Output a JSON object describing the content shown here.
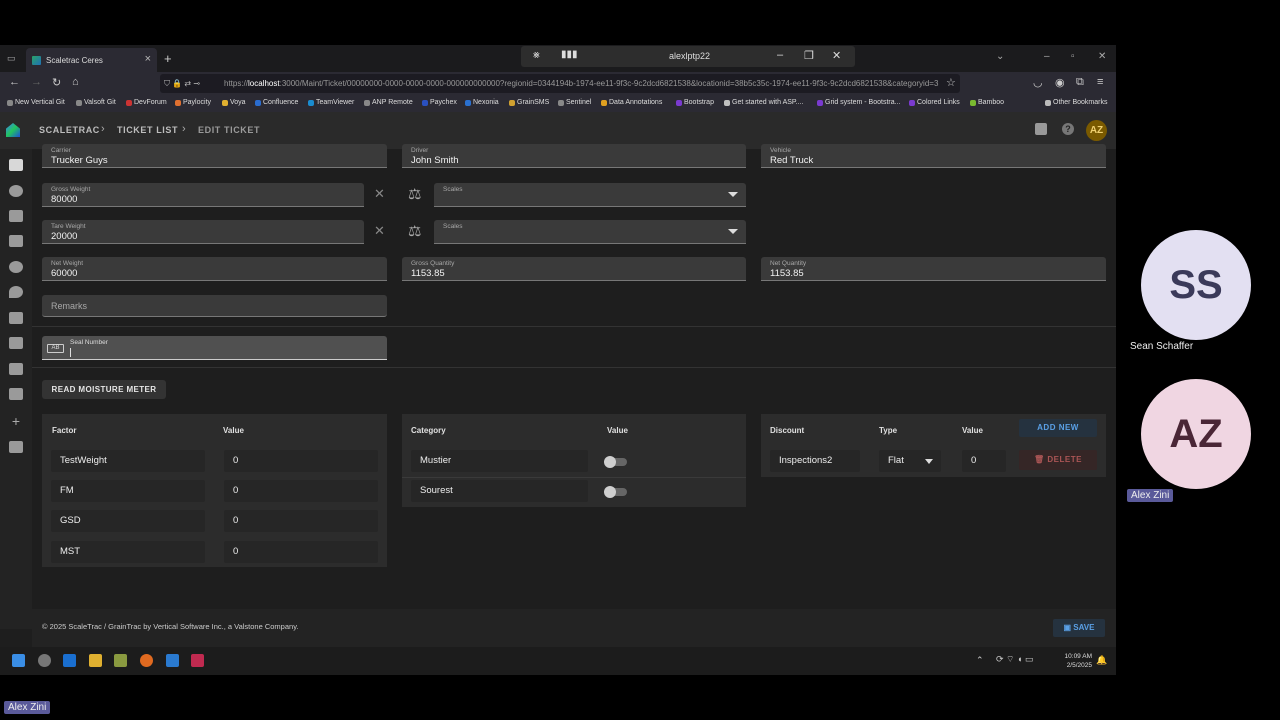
{
  "browser": {
    "tab_title": "Scaletrac Ceres",
    "remote_host": "alexlptp22",
    "url_prefix": "https://",
    "url_host": "localhost",
    "url_rest": ":3000/Maint/Ticket/00000000-0000-0000-0000-000000000000?regionid=0344194b-1974-ee11-9f3c-9c2dcd6821538&locationid=38b5c35c-1974-ee11-9f3c-9c2dcd6821538&categoryid=3",
    "bookmarks": [
      "New Vertical Git",
      "Valsoft Git",
      "DevForum",
      "Paylocity",
      "Voya",
      "Confluence",
      "TeamViewer",
      "ANP Remote",
      "Paychex",
      "Nexonia",
      "GrainSMS",
      "Sentinel",
      "Data Annotations",
      "Bootstrap",
      "Get started with ASP....",
      "Grid system - Bootstra...",
      "Colored Links",
      "Bamboo"
    ],
    "other_bookmarks": "Other Bookmarks"
  },
  "app": {
    "breadcrumb": [
      "SCALETRAC",
      "TICKET LIST",
      "EDIT TICKET"
    ],
    "avatar_initials": "AZ"
  },
  "form": {
    "carrier": {
      "label": "Carrier",
      "value": "Trucker Guys"
    },
    "driver": {
      "label": "Driver",
      "value": "John Smith"
    },
    "vehicle": {
      "label": "Vehicle",
      "value": "Red Truck"
    },
    "gross_weight": {
      "label": "Gross Weight",
      "value": "80000"
    },
    "gross_scales": {
      "label": "Scales",
      "value": ""
    },
    "tare_weight": {
      "label": "Tare Weight",
      "value": "20000"
    },
    "tare_scales": {
      "label": "Scales",
      "value": ""
    },
    "net_weight": {
      "label": "Net Weight",
      "value": "60000"
    },
    "gross_quantity": {
      "label": "Gross Quantity",
      "value": "1153.85"
    },
    "net_quantity": {
      "label": "Net Quantity",
      "value": "1153.85"
    },
    "remarks_placeholder": "Remarks",
    "seal_number": {
      "label": "Seal Number",
      "value": "",
      "badge": "AB"
    },
    "read_moisture_label": "READ MOISTURE METER"
  },
  "factors": {
    "headers": [
      "Factor",
      "Value"
    ],
    "rows": [
      {
        "factor": "TestWeight",
        "value": "0"
      },
      {
        "factor": "FM",
        "value": "0"
      },
      {
        "factor": "GSD",
        "value": "0"
      },
      {
        "factor": "MST",
        "value": "0"
      }
    ]
  },
  "categories": {
    "headers": [
      "Category",
      "Value"
    ],
    "rows": [
      {
        "category": "Mustier",
        "on": false
      },
      {
        "category": "Sourest",
        "on": false
      }
    ]
  },
  "discounts": {
    "headers": [
      "Discount",
      "Type",
      "Value"
    ],
    "add_label": "ADD NEW",
    "rows": [
      {
        "discount": "Inspections2",
        "type": "Flat",
        "value": "0",
        "delete_label": "DELETE"
      }
    ]
  },
  "footer": {
    "copyright": "© 2025 ScaleTrac / GrainTrac by Vertical Software Inc., a Valstone Company.",
    "save_label": "SAVE"
  },
  "taskbar": {
    "time": "10:09 AM",
    "date": "2/5/2025"
  },
  "call": {
    "participants": [
      {
        "initials": "SS",
        "name": "Sean Schaffer",
        "color": "#e3e0f2",
        "text_color": "#3b3a5a"
      },
      {
        "initials": "AZ",
        "name": "Alex Zini",
        "color": "#f0d6e2",
        "text_color": "#4a2636"
      }
    ],
    "self_name": "Alex Zini"
  }
}
